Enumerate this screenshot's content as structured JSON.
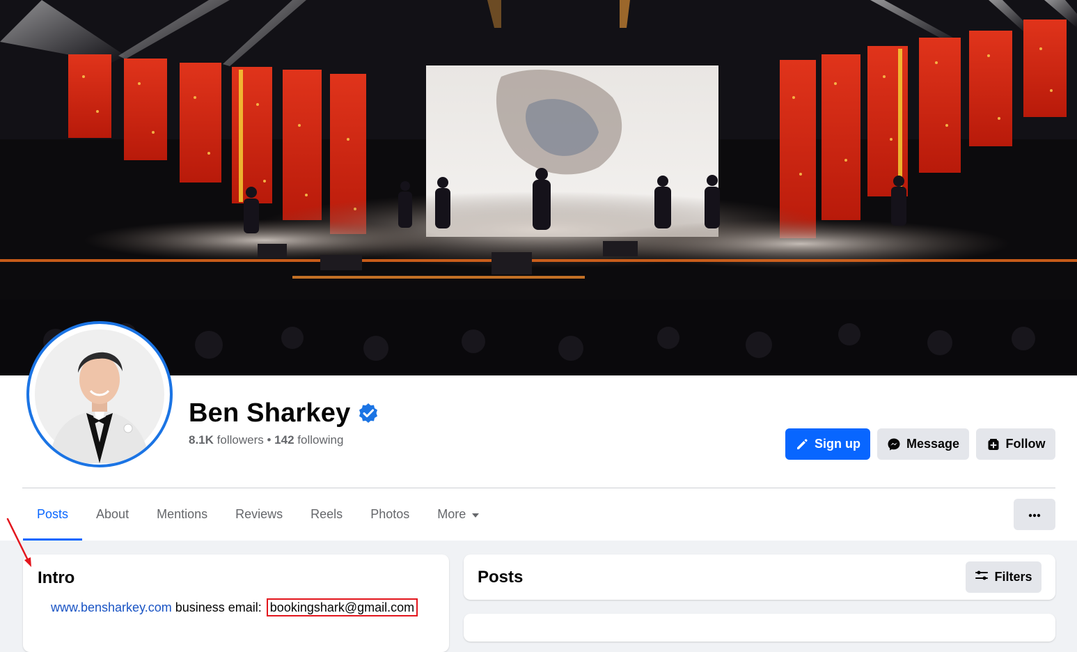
{
  "profile": {
    "name": "Ben Sharkey",
    "followers_count": "8.1K",
    "followers_label": "followers",
    "separator": " • ",
    "following_count": "142",
    "following_label": "following"
  },
  "actions": {
    "signup_label": "Sign up",
    "message_label": "Message",
    "follow_label": "Follow"
  },
  "tabs": [
    {
      "label": "Posts",
      "active": true
    },
    {
      "label": "About",
      "active": false
    },
    {
      "label": "Mentions",
      "active": false
    },
    {
      "label": "Reviews",
      "active": false
    },
    {
      "label": "Reels",
      "active": false
    },
    {
      "label": "Photos",
      "active": false
    },
    {
      "label": "More",
      "active": false
    }
  ],
  "intro": {
    "title": "Intro",
    "website": "www.bensharkey.com",
    "business_label": " business email: ",
    "email": "bookingshark@gmail.com"
  },
  "posts": {
    "title": "Posts",
    "filters_label": "Filters"
  },
  "colors": {
    "primary": "#0866ff",
    "verified": "#1b74e4",
    "annotation": "#e3161d"
  },
  "icons": {
    "verified": "verified-badge-icon",
    "signup": "pencil-icon",
    "message": "messenger-icon",
    "follow": "follow-icon",
    "more": "caret-down-icon",
    "dots": "more-dots-icon",
    "filters": "filters-icon"
  }
}
